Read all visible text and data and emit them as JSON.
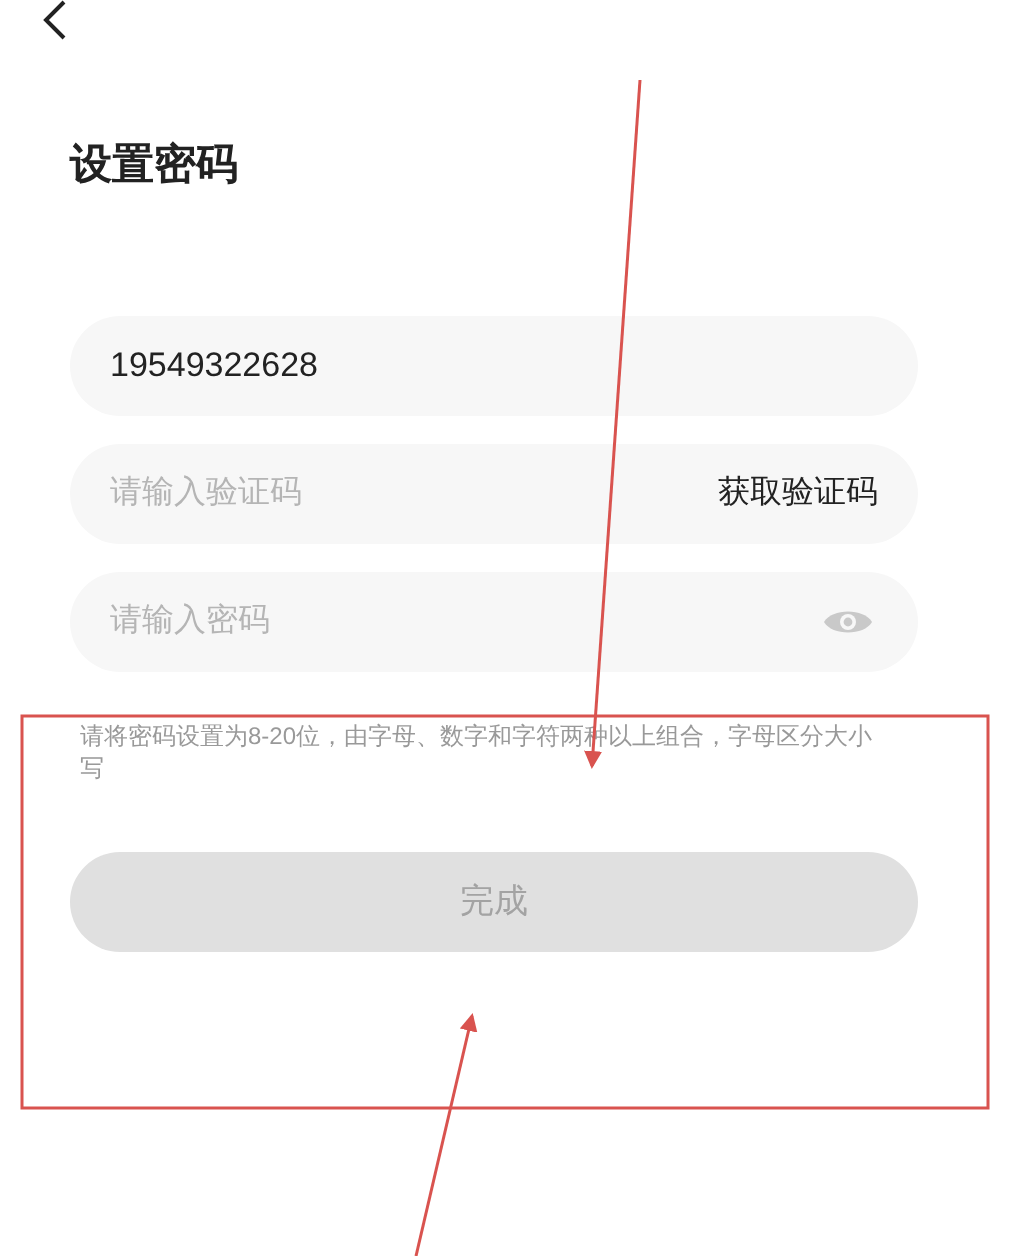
{
  "title": "设置密码",
  "fields": [
    {
      "kind": "value",
      "value": "19549322628"
    },
    {
      "kind": "code",
      "placeholder": "请输入验证码",
      "action": "获取验证码"
    },
    {
      "kind": "password",
      "placeholder": "请输入密码"
    }
  ],
  "hint": "请将密码设置为8-20位，由字母、数字和字符两种以上组合，字母区分大小写",
  "submit": {
    "label": "完成",
    "disabled": true
  },
  "annotations": [
    {
      "kind": "box"
    },
    {
      "kind": "arrow"
    },
    {
      "kind": "arrow"
    }
  ]
}
